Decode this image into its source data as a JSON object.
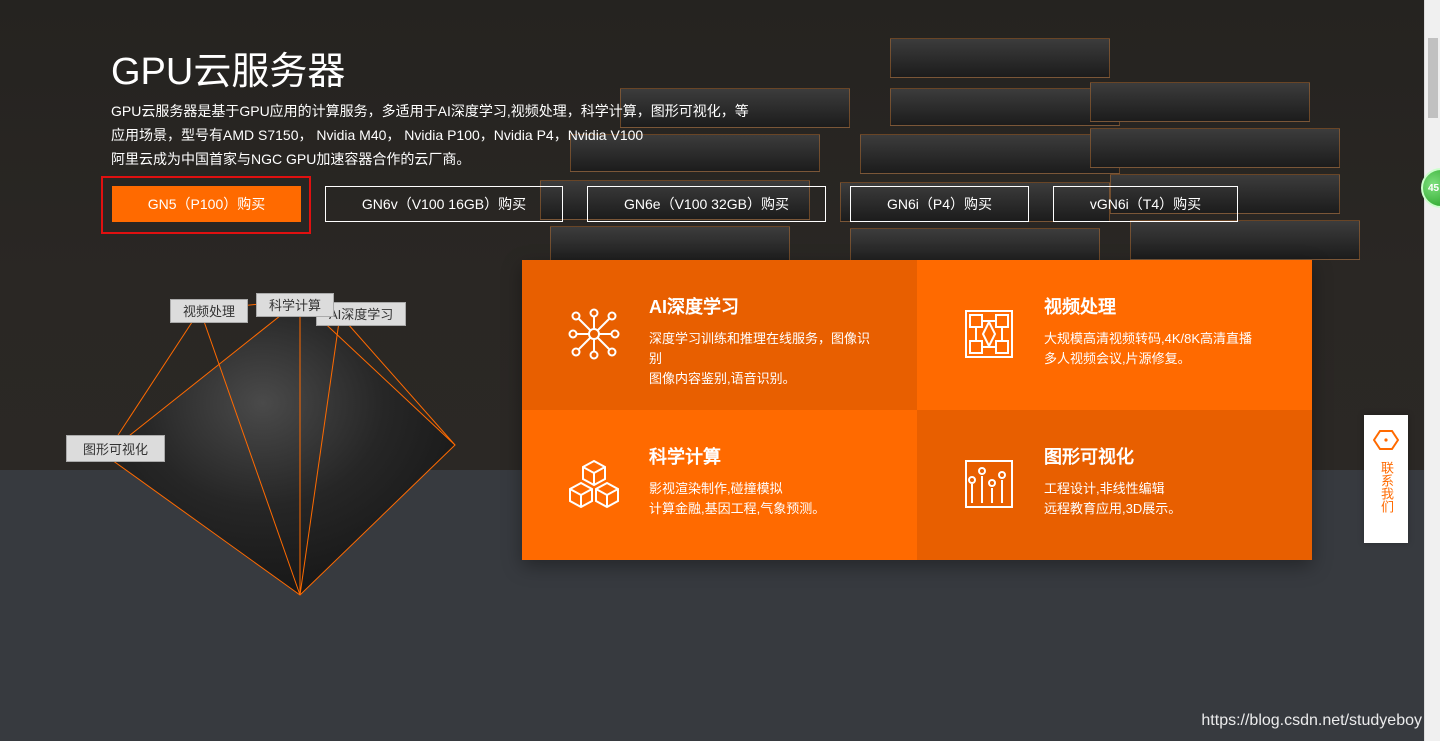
{
  "header": {
    "title": "GPU云服务器",
    "description": [
      "GPU云服务器是基于GPU应用的计算服务，多适用于AI深度学习,视频处理，科学计算，图形可视化，等",
      "应用场景，型号有AMD S7150， Nvidia M40， Nvidia P100，Nvidia P4，Nvidia V100",
      "阿里云成为中国首家与NGC GPU加速容器合作的云厂商。"
    ]
  },
  "buttons": [
    {
      "label": "GN5（P100）购买"
    },
    {
      "label": "GN6v（V100 16GB）购买"
    },
    {
      "label": "GN6e（V100 32GB）购买"
    },
    {
      "label": "GN6i（P4）购买"
    },
    {
      "label": "vGN6i（T4）购买"
    }
  ],
  "pyramid_labels": [
    "视频处理",
    "科学计算",
    "AI深度学习",
    "图形可视化"
  ],
  "cards": [
    {
      "icon": "neural-network-icon",
      "title": "AI深度学习",
      "lines": [
        "深度学习训练和推理在线服务，图像识别",
        "图像内容鉴别,语音识别。"
      ],
      "color": "#e85f00"
    },
    {
      "icon": "video-grid-icon",
      "title": "视频处理",
      "lines": [
        "大规模高清视频转码,4K/8K高清直播",
        "多人视频会议,片源修复。"
      ],
      "color": "#ff6a00"
    },
    {
      "icon": "cubes-icon",
      "title": "科学计算",
      "lines": [
        "影视渲染制作,碰撞模拟",
        "计算金融,基因工程,气象预测。"
      ],
      "color": "#ff6a00"
    },
    {
      "icon": "bar-chart-icon",
      "title": "图形可视化",
      "lines": [
        "工程设计,非线性编辑",
        "远程教育应用,3D展示。"
      ],
      "color": "#e85f00"
    }
  ],
  "contact": {
    "label": "联系我们"
  },
  "badge": {
    "text": "45"
  },
  "watermark": "https://blog.csdn.net/studyeboy",
  "colors": {
    "accent": "#ff6a00",
    "highlight_border": "#e01010"
  }
}
